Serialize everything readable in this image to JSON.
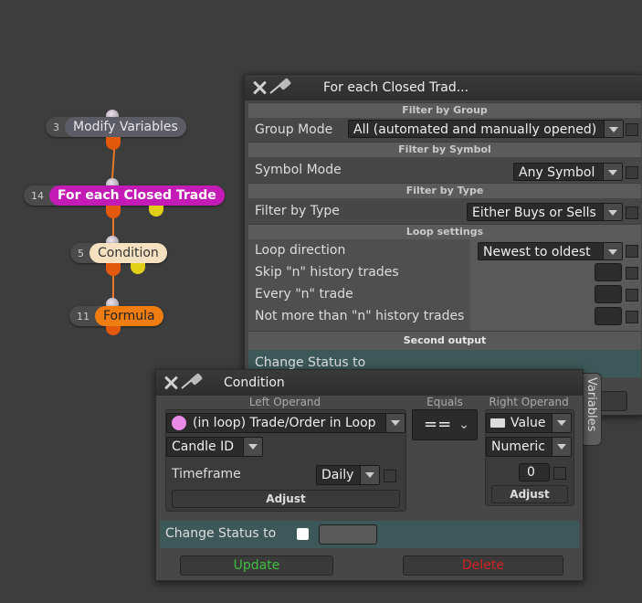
{
  "nodes": [
    {
      "num": "3",
      "label": "Modify Variables",
      "color": "#5c5c66",
      "text_color": "#e6e6e6"
    },
    {
      "num": "14",
      "label": "For each Closed Trade",
      "color": "#c41bb7",
      "text_color": "#ffffff"
    },
    {
      "num": "5",
      "label": "Condition",
      "color": "#f5e1c0",
      "text_color": "#333333"
    },
    {
      "num": "11",
      "label": "Formula",
      "color": "#ef7d10",
      "text_color": "#222222"
    }
  ],
  "loop_window": {
    "title": "For each Closed Trad...",
    "sections": {
      "group": "Filter by Group",
      "symbol": "Filter by Symbol",
      "type": "Filter by Type",
      "loop": "Loop settings",
      "second": "Second output"
    },
    "group_mode_label": "Group Mode",
    "group_mode_value": "All (automated and manually opened)",
    "symbol_mode_label": "Symbol Mode",
    "symbol_mode_value": "Any Symbol",
    "filter_type_label": "Filter by Type",
    "filter_type_value": "Either Buys or Sells",
    "loop_direction_label": "Loop direction",
    "loop_direction_value": "Newest to oldest",
    "skip_label": "Skip \"n\" history trades",
    "every_label": "Every \"n\" trade",
    "not_more_label": "Not more than \"n\" history trades",
    "change_status_label": "Change Status to",
    "variables_tab": "Variables"
  },
  "condition_window": {
    "title": "Condition",
    "left_operand_label": "Left Operand",
    "equals_label": "Equals",
    "right_operand_label": "Right Operand",
    "left_value": "(in loop) Trade/Order in Loop",
    "left_field": "Candle ID",
    "timeframe_label": "Timeframe",
    "timeframe_value": "Daily",
    "adjust_left": "Adjust",
    "operator": "==",
    "right_type": "Value",
    "right_format": "Numeric",
    "right_value": "0",
    "adjust_right": "Adjust",
    "change_status_label": "Change Status to",
    "update_button": "Update",
    "delete_button": "Delete",
    "colors": {
      "update": "#3fbf3f",
      "delete": "#d42020",
      "left_dot": "#e98ae6"
    }
  }
}
